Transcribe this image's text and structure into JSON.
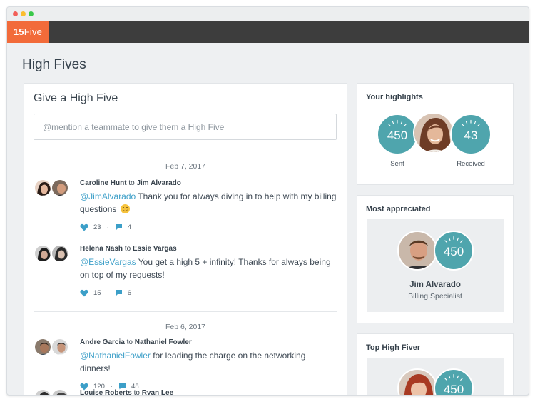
{
  "app": {
    "logo_number": "15",
    "logo_word": "Five"
  },
  "page": {
    "title": "High Fives"
  },
  "give": {
    "title": "Give a High Five",
    "placeholder": "@mention a teammate to give them a High Five"
  },
  "feed": {
    "groups": [
      {
        "date": "Feb 7, 2017",
        "posts": [
          {
            "from": "Caroline Hunt",
            "to_word": "to",
            "to": "Jim Alvarado",
            "mention": "@JimAlvarado",
            "text": " Thank you for always diving in to help with my billing questions",
            "has_emoji": true,
            "likes": "23",
            "comments": "4"
          },
          {
            "from": "Helena Nash",
            "to_word": "to",
            "to": "Essie Vargas",
            "mention": "@EssieVargas",
            "text": " You get a high 5 + infinity! Thanks for always being on top of my requests!",
            "likes": "15",
            "comments": "6"
          }
        ]
      },
      {
        "date": "Feb 6, 2017",
        "posts": [
          {
            "from": "Andre Garcia",
            "to_word": "to",
            "to": "Nathaniel Fowler",
            "mention": "@NathanielFowler",
            "text": " for leading the charge on the networking dinners!",
            "likes": "120",
            "comments": "48"
          },
          {
            "from": "Louise Roberts",
            "to_word": "to",
            "to": "Ryan Lee"
          }
        ]
      }
    ]
  },
  "highlights": {
    "title": "Your highlights",
    "sent_value": "450",
    "sent_label": "Sent",
    "received_value": "43",
    "received_label": "Received"
  },
  "most_appreciated": {
    "title": "Most appreciated",
    "value": "450",
    "name": "Jim Alvarado",
    "role": "Billing Specialist"
  },
  "top_high_fiver": {
    "title": "Top High Fiver",
    "value": "450"
  },
  "colors": {
    "brand": "#f26b3a",
    "teal": "#4fa5ad",
    "link": "#3c9fc8"
  },
  "icons": {
    "likes": "heart-icon",
    "comments": "comment-icon"
  }
}
